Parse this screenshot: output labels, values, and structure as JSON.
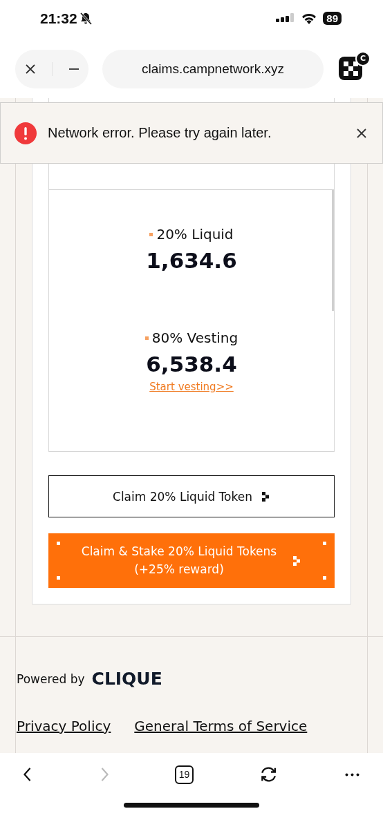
{
  "status_bar": {
    "time": "21:32",
    "battery": "89"
  },
  "browser_bar": {
    "url": "claims.campnetwork.xyz",
    "extension_badge": "C"
  },
  "toast": {
    "message": "Network error. Please try again later."
  },
  "allocations": [
    {
      "label": "20% Liquid",
      "amount": "1,634.6"
    },
    {
      "label": "80% Vesting",
      "amount": "6,538.4",
      "link": "Start vesting>>"
    }
  ],
  "buttons": [
    {
      "kind": "outline",
      "lines": [
        "Claim 20% Liquid Token"
      ]
    },
    {
      "kind": "primary",
      "lines": [
        "Claim & Stake 20% Liquid Tokens",
        "(+25% reward)"
      ]
    }
  ],
  "footer": {
    "powered_by": "Powered by",
    "logo": "CLIQUE",
    "links": [
      "Privacy Policy",
      "General Terms of Service"
    ]
  },
  "toolbar": [
    {
      "kind": "back",
      "disabled": false
    },
    {
      "kind": "forward",
      "disabled": true
    },
    {
      "kind": "tabs",
      "label": "19",
      "disabled": false
    },
    {
      "kind": "reload",
      "disabled": false
    },
    {
      "kind": "more",
      "disabled": false
    }
  ]
}
